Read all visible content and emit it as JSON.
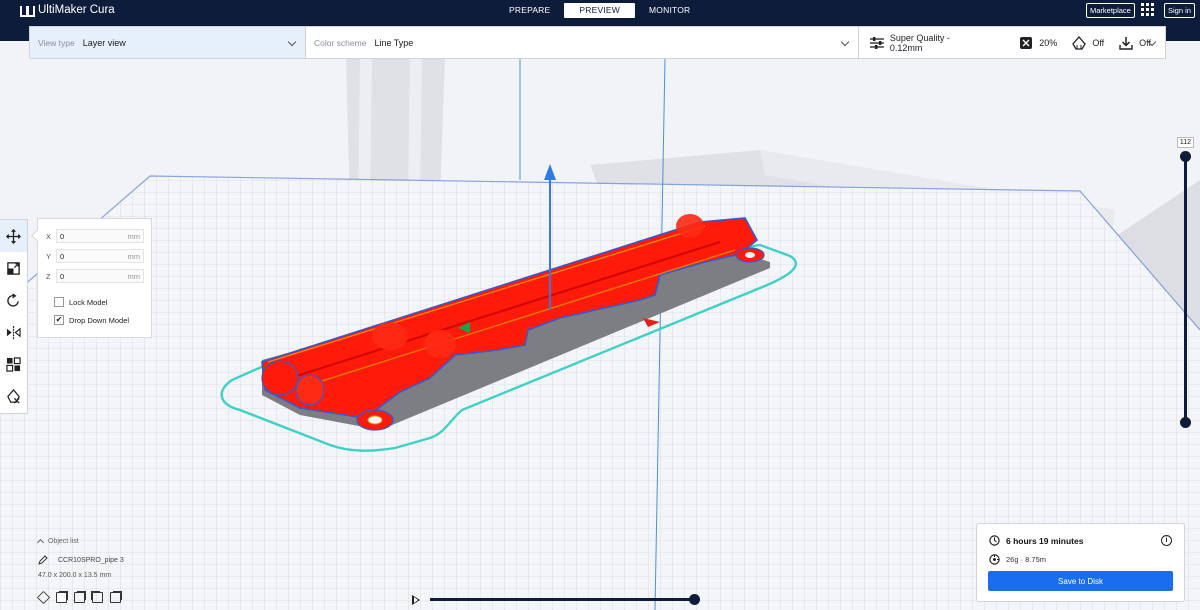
{
  "app": {
    "title": "UltiMaker Cura"
  },
  "stages": [
    {
      "label": "PREPARE",
      "active": false
    },
    {
      "label": "PREVIEW",
      "active": true
    },
    {
      "label": "MONITOR",
      "active": false
    }
  ],
  "topbar": {
    "marketplace_label": "Marketplace",
    "signin_label": "Sign in"
  },
  "view_settings": {
    "view_type_label": "View type",
    "view_type_value": "Layer view",
    "color_scheme_label": "Color scheme",
    "color_scheme_value": "Line Type"
  },
  "print_settings": {
    "profile": "Super Quality - 0.12mm",
    "infill": "20%",
    "support": "Off",
    "adhesion": "Off"
  },
  "move_panel": {
    "x_label": "X",
    "x_value": "0",
    "y_label": "Y",
    "y_value": "0",
    "z_label": "Z",
    "z_value": "0",
    "unit": "mm",
    "lock_model_label": "Lock Model",
    "lock_model_checked": false,
    "drop_down_label": "Drop Down Model",
    "drop_down_checked": true
  },
  "layer_slider": {
    "current_layer": "112",
    "level": 1.0
  },
  "object_list": {
    "title": "Object list",
    "object_name": "CCR10SPRO_pipe 3",
    "dimensions": "47.0 x 200.0 x 13.5 mm"
  },
  "playback": {
    "progress": 1.0
  },
  "print_info": {
    "time": "6 hours 19 minutes",
    "material": "26g · 8.75m",
    "save_label": "Save to Disk"
  },
  "colors": {
    "topbar": "#0e1c3c",
    "accent_blue": "#196ef0",
    "model_red": "#ff1a0a",
    "skirt_cyan": "#3fd0c8"
  }
}
